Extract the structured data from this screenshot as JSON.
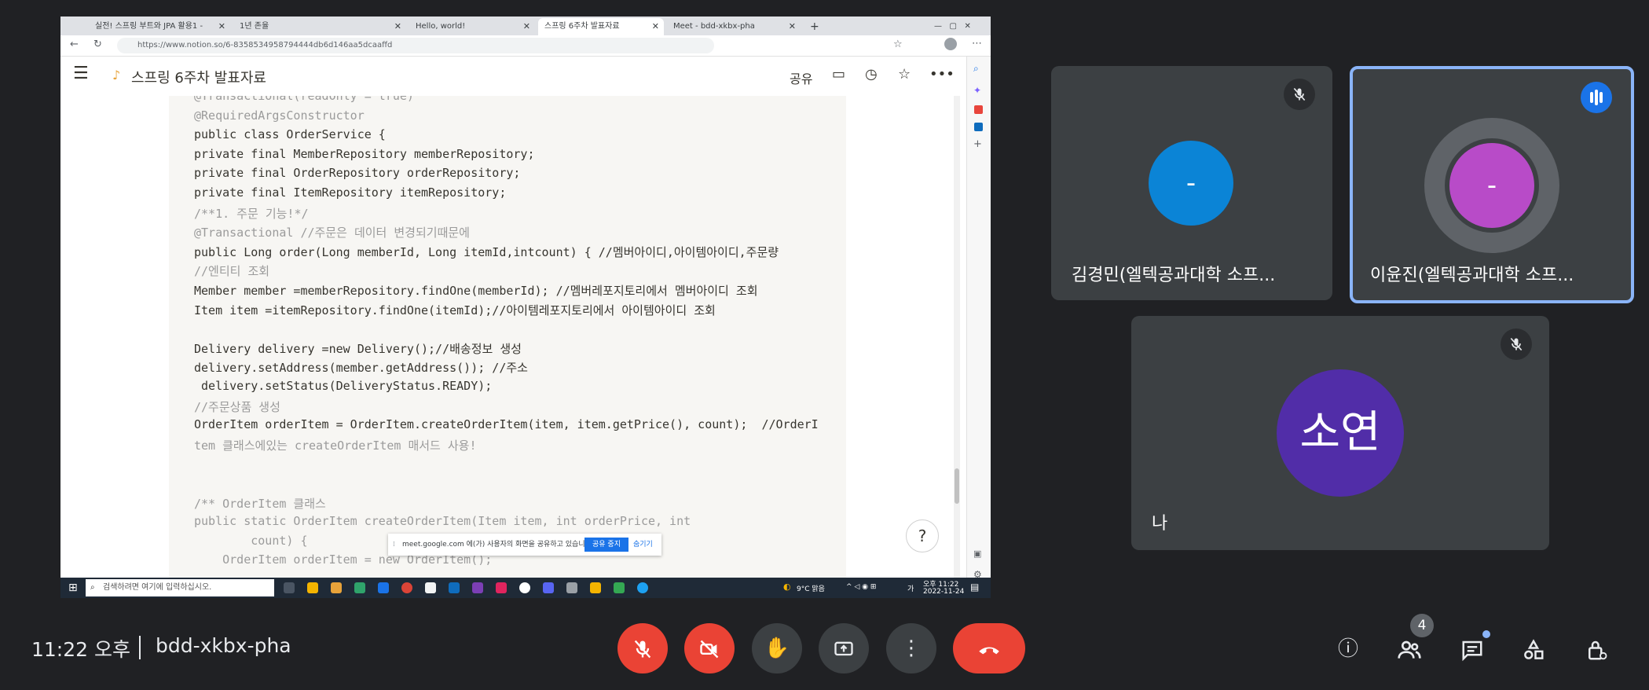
{
  "shared_screen": {
    "tabs": [
      {
        "label": "실전! 스프링 부트와 JPA 활용1 -",
        "active": false
      },
      {
        "label": "1년 존율",
        "active": false
      },
      {
        "label": "Hello, world!",
        "active": false
      },
      {
        "label": "스프링 6주차 발표자료",
        "active": true
      },
      {
        "label": "Meet - bdd-xkbx-pha",
        "active": false
      }
    ],
    "url": "https://www.notion.so/6-8358534958794444db6d146aa5dcaaffd",
    "page_title": "스프링 6주차 발표자료",
    "share_label": "공유",
    "code_lines": [
      {
        "text": "@Transactional(readOnly = true)",
        "color": "#9b9b9b"
      },
      {
        "text": "@RequiredArgsConstructor",
        "color": "#9b9b9b"
      },
      {
        "text": "public class OrderService {",
        "color": "#37352f"
      },
      {
        "text": "private final MemberRepository memberRepository;",
        "color": "#37352f"
      },
      {
        "text": "private final OrderRepository orderRepository;",
        "color": "#37352f"
      },
      {
        "text": "private final ItemRepository itemRepository;",
        "color": "#37352f"
      },
      {
        "text": "/**1. 주문 기능!*/",
        "color": "#9b9b9b"
      },
      {
        "text": "@Transactional //주문은 데이터 변경되기때문에",
        "color": "#9b9b9b"
      },
      {
        "text": "public Long order(Long memberId, Long itemId,intcount) { //멤버아이디,아이템아이디,주문량",
        "color": "#37352f"
      },
      {
        "text": "//엔티티 조회",
        "color": "#9b9b9b"
      },
      {
        "text": "Member member =memberRepository.findOne(memberId); //멤버레포지토리에서 멤버아이디 조회",
        "color": "#37352f"
      },
      {
        "text": "Item item =itemRepository.findOne(itemId);//아이템레포지토리에서 아이템아이디 조회",
        "color": "#37352f"
      },
      {
        "text": "",
        "color": "#37352f"
      },
      {
        "text": "Delivery delivery =new Delivery();//배송정보 생성",
        "color": "#37352f"
      },
      {
        "text": "delivery.setAddress(member.getAddress()); //주소",
        "color": "#37352f"
      },
      {
        "text": " delivery.setStatus(DeliveryStatus.READY);",
        "color": "#37352f"
      },
      {
        "text": "//주문상품 생성",
        "color": "#9b9b9b"
      },
      {
        "text": "OrderItem orderItem = OrderItem.createOrderItem(item, item.getPrice(), count);  //OrderI",
        "color": "#37352f"
      },
      {
        "text": "tem 클래스에있는 createOrderItem 매서드 사용!",
        "color": "#9b9b9b"
      },
      {
        "text": "",
        "color": "#37352f"
      },
      {
        "text": "",
        "color": "#37352f"
      },
      {
        "text": "/** OrderItem 클래스",
        "color": "#9b9b9b"
      },
      {
        "text": "public static OrderItem createOrderItem(Item item, int orderPrice, int",
        "color": "#9b9b9b"
      },
      {
        "text": "        count) {",
        "color": "#9b9b9b"
      },
      {
        "text": "    OrderItem orderItem = new OrderItem();",
        "color": "#9b9b9b"
      }
    ],
    "help_label": "?",
    "share_notice": {
      "text": "meet.google.com 에(가) 사용자의 화면을 공유하고 있습니다.",
      "stop_label": "공유 중지",
      "hide_label": "숨기기"
    },
    "taskbar": {
      "search_placeholder": "검색하려면 여기에 입력하십시오.",
      "weather": "9°C 맑음",
      "clock_time": "오후 11:22",
      "clock_date": "2022-11-24",
      "ime": "가"
    }
  },
  "participants": [
    {
      "name": "김경민(엘텍공과대학 소프...",
      "initial": "-",
      "avatar_color": "#0b84d6",
      "muted": true,
      "speaking": false
    },
    {
      "name": "이윤진(엘텍공과대학 소프...",
      "initial": "-",
      "avatar_color": "#b84bc8",
      "muted": false,
      "speaking": true
    },
    {
      "name": "나",
      "initial": "소연",
      "avatar_color": "#512da8",
      "muted": true,
      "speaking": false
    }
  ],
  "bottom_bar": {
    "time": "11:22 오후",
    "meeting_code": "bdd-xkbx-pha",
    "people_count": "4"
  },
  "colors": {
    "background": "#202124",
    "tile": "#3c4043",
    "danger": "#ea4335",
    "active_border": "#8ab4f8",
    "speaking_badge": "#1a73e8"
  }
}
